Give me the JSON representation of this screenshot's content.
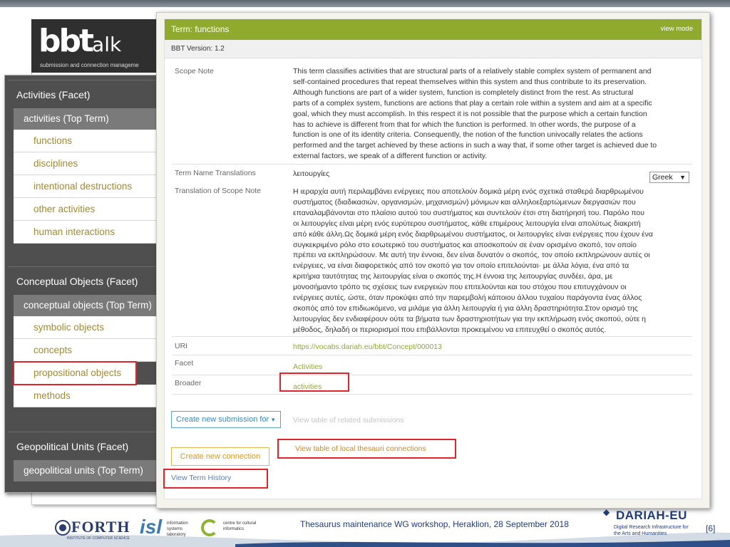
{
  "logo": {
    "brand": "bbt",
    "brand_suffix": "alk",
    "subtitle": "submission and connection manageme"
  },
  "facets": [
    {
      "title": "Activities (Facet)",
      "top_term": "activities (Top Term)",
      "terms": [
        "functions",
        "disciplines",
        "intentional destructions",
        "other activities",
        "human interactions"
      ]
    },
    {
      "title": "Conceptual Objects (Facet)",
      "top_term": "conceptual objects (Top Term)",
      "terms": [
        "symbolic objects",
        "concepts",
        "propositional objects",
        "methods"
      ]
    },
    {
      "title": "Geopolitical Units (Facet)",
      "top_term": "geopolitical units (Top Term)",
      "terms": []
    }
  ],
  "term_window": {
    "title": "Term: functions",
    "view_mode": "view mode",
    "version": "BBT Version: 1.2",
    "fields": {
      "scope_note_label": "Scope Note",
      "scope_note_lines": [
        "This term classifies activities that are structural parts of a relatively stable complex system of permanent and",
        "self-contained procedures that repeat themselves within this system and thus contribute to its preservation.",
        "Although functions are part of a wider system, function is completely distinct from the rest. As structural",
        "parts of a complex system, functions are actions that play a certain role within a system and aim at a specific",
        "goal, which they must accomplish. In this respect it is not possible that the purpose which a certain function",
        "has to achieve is different from that for which the function is performed. In other words, the purpose of a",
        "function is one of its identity criteria. Consequently, the notion of the function univocally relates the actions",
        "performed and the target achieved by these actions in such a way that, if some other target is achieved due to",
        "external factors, we speak of a different function or activity."
      ],
      "translations_label": "Term Name Translations",
      "translation_value": "λειτουργίες",
      "language": "Greek",
      "translation_scope_label": "Translation of Scope Note",
      "translation_scope_lines": [
        "Η ιεραρχία αυτή περιλαμβάνει ενέργειες που αποτελούν δομικά μέρη ενός σχετικά σταθερά διαρθρωμένου",
        "συστήματος (διαδικασιών, οργανισμών, μηχανισμών) μόνιμων και αλληλοεξαρτώμενων διεργασιών που",
        "επαναλαμβάνονται στο πλαίσιο αυτού του συστήματος και συντελούν έτσι στη διατήρησή του. Παρόλο που",
        "οι λειτουργίες είναι μέρη ενός ευρύτερου συστήματος, κάθε επιμέρους λειτουργία είναι απολύτως διακριτή",
        "από κάθε άλλη.Ως δομικά μέρη ενός διαρθρωμένου συστήματος, οι λειτουργίες είναι ενέργειες που έχουν ένα",
        "συγκεκριμένο ρόλο στο εσωτερικό του συστήματος και αποσκοπούν σε έναν ορισμένο σκοπό, τον οποίο",
        "πρέπει να εκπληρώσουν. Με αυτή την έννοια, δεν είναι δυνατόν ο σκοπός, τον οποίο εκπληρώνουν αυτές οι",
        "ενέργειες, να είναι διαφορετικός από τον σκοπό για τον οποίο επιτελούνται· με άλλα λόγια, ένα από τα",
        "κριτήρια ταυτότητας της λειτουργίας είναι ο σκοπός της.Η έννοια της λειτουργίας συνδέει, άρα, με",
        "μονοσήμαντο τρόπο τις σχέσεις των ενεργειών που επιτελούνται και του στόχου που επιτυγχάνουν οι",
        "ενέργειες αυτές, ώστε, όταν προκύψει από την παρεμβολή κάποιου άλλου τυχαίου παράγοντα ένας άλλος",
        "σκοπός από τον επιδιωκόμενο, να μιλάμε για άλλη λειτουργία ή για άλλη δραστηριότητα.Στον ορισμό της",
        "λειτουργίας δεν ενδιαφέρουν ούτε τα βήματα των δραστηριοτήτων για την εκπλήρωση ενός σκοπού, ούτε η",
        "μέθοδος, δηλαδή οι περιορισμοί που επιβάλλονται προκειμένου να επιτευχθεί ο σκοπός αυτός."
      ],
      "uri_label": "URI",
      "uri_value": "https://vocabs.dariah.eu/bbt/Concept/000013",
      "facet_label": "Facet",
      "facet_value": "Activities",
      "broader_label": "Broader",
      "broader_value": "activities"
    },
    "actions": {
      "create_submission": "Create new submission for",
      "view_related_submissions": "View table of related submissions",
      "create_connection": "Create new connection",
      "view_local_connections": "View table of local thesauri connections",
      "view_term_history": "View Term History"
    }
  },
  "footer": {
    "forth": "FORTH",
    "forth_sub": "INSTITUTE OF COMPUTER SCIENCE",
    "isl": "isl",
    "isl_sub": "information systems laboratory",
    "cci_sub": "centre for cultural informatics",
    "workshop_text": "Thesaurus maintenance WG workshop, Heraklion, 28 September 2018",
    "dariah": "DARIAH-EU",
    "dariah_sub": "Digital Research Infrastructure for the Arts and Humanities",
    "page_number": "[6]"
  },
  "colors": {
    "header_green": "#8faa2c",
    "link_gold": "#a38a2b",
    "highlight_red": "#e0242c",
    "footer_blue": "#1f3c7a"
  }
}
